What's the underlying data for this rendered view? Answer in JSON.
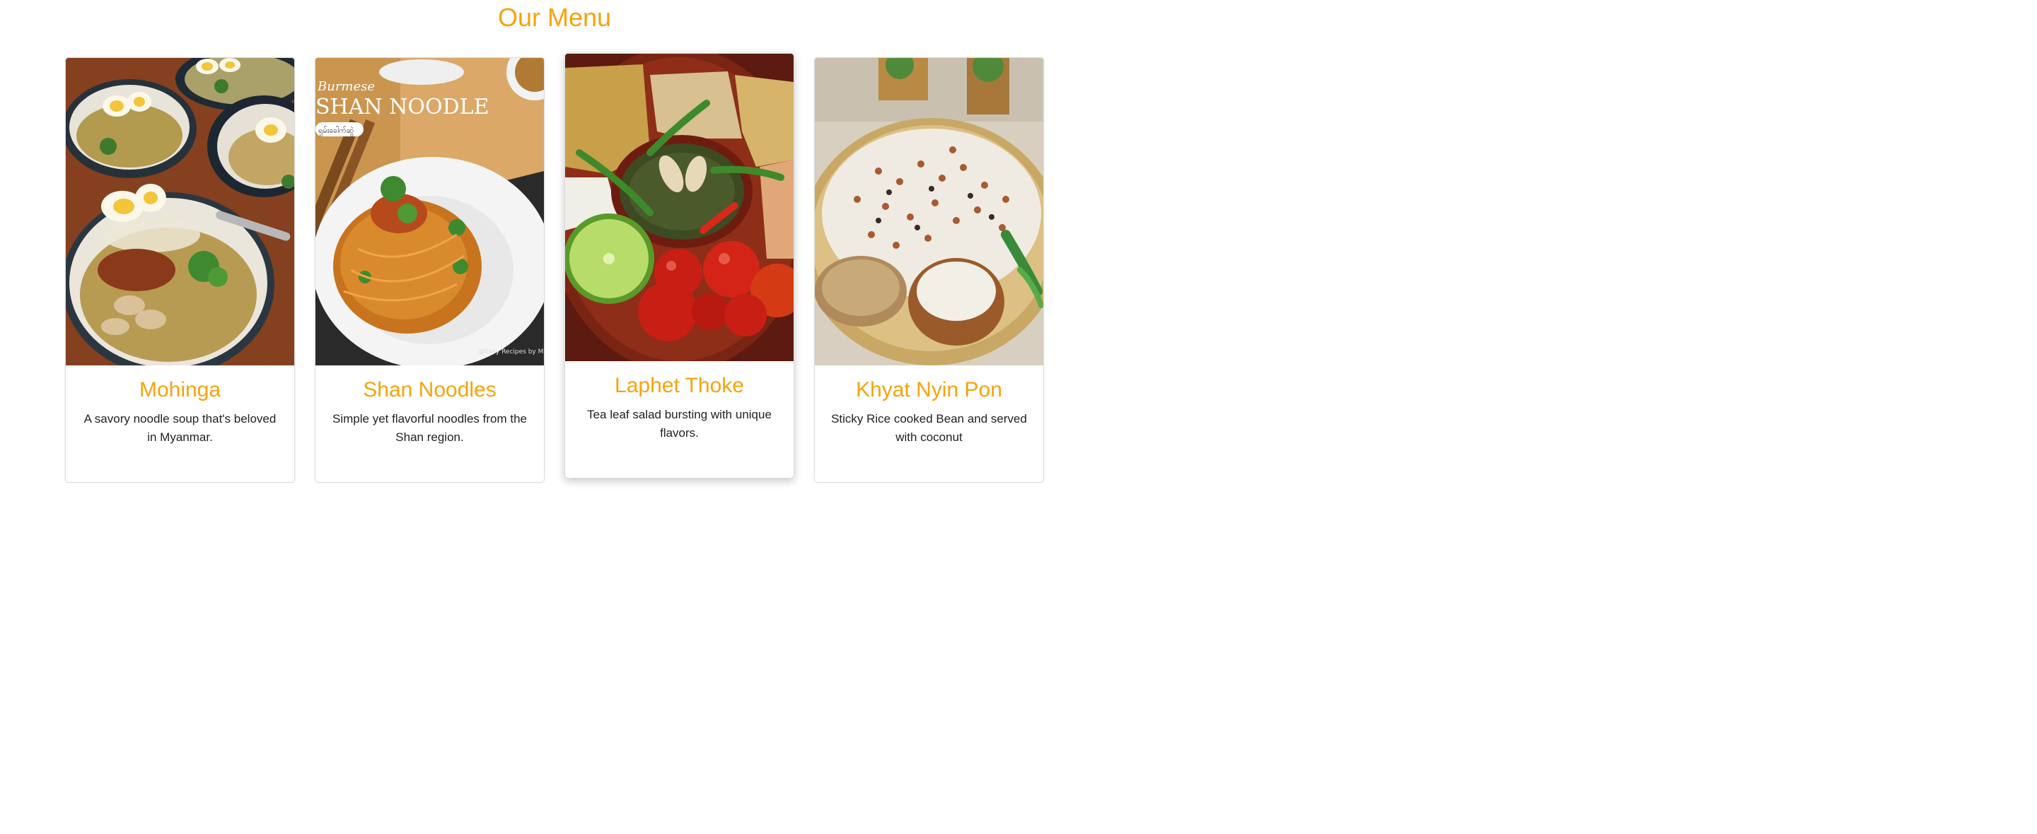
{
  "menu": {
    "title": "Our Menu",
    "items": [
      {
        "name": "Mohinga",
        "description": "A savory noodle soup that's beloved in Myanmar."
      },
      {
        "name": "Shan Noodles",
        "description": "Simple yet flavorful noodles from the Shan region.",
        "image_text": {
          "script_word": "Burmese",
          "headline": "SHAN NOODLE",
          "pill": "ရှမ်းခေါက်ဆွဲ",
          "credit": "@Easy Recipes by M"
        }
      },
      {
        "name": "Laphet Thoke",
        "description": "Tea leaf salad bursting with unique flavors."
      },
      {
        "name": "Khyat Nyin Pon",
        "description": "Sticky Rice cooked Bean and served with coconut"
      }
    ]
  },
  "colors": {
    "accent": "#f7a30a",
    "text": "#222222"
  }
}
